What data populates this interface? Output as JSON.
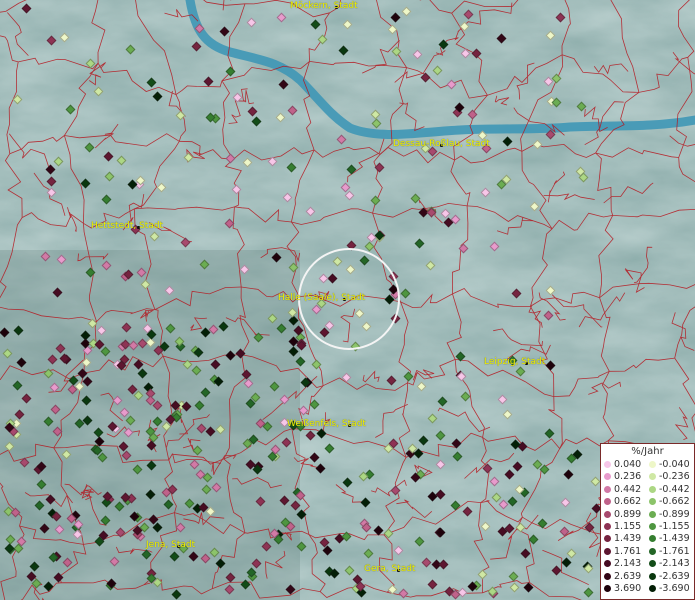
{
  "map": {
    "cities": [
      {
        "name": "Möckern, Stadt"
      },
      {
        "name": "Dessau-Roßlau, Stadt"
      },
      {
        "name": "Hettstedt, Stadt"
      },
      {
        "name": "Halle (Saale), Stadt"
      },
      {
        "name": "Leipzig, Stadt"
      },
      {
        "name": "Weißenfels, Stadt"
      },
      {
        "name": "Jena, Stadt"
      },
      {
        "name": "Gera, Stadt"
      }
    ]
  },
  "legend": {
    "title": "%/Jahr",
    "positive": [
      {
        "label": "0.040",
        "color": "#f7c6e8"
      },
      {
        "label": "0.236",
        "color": "#e89bcc"
      },
      {
        "label": "0.442",
        "color": "#d27aa6"
      },
      {
        "label": "0.662",
        "color": "#c0628a"
      },
      {
        "label": "0.899",
        "color": "#a84a6e"
      },
      {
        "label": "1.155",
        "color": "#8e3354"
      },
      {
        "label": "1.439",
        "color": "#762440"
      },
      {
        "label": "1.761",
        "color": "#5e1630"
      },
      {
        "label": "2.143",
        "color": "#470c22"
      },
      {
        "label": "2.639",
        "color": "#330616"
      },
      {
        "label": "3.690",
        "color": "#1e020b"
      }
    ],
    "negative": [
      {
        "label": "-0.040",
        "color": "#eef7c8"
      },
      {
        "label": "-0.236",
        "color": "#cfe8a4"
      },
      {
        "label": "-0.442",
        "color": "#acd784"
      },
      {
        "label": "-0.662",
        "color": "#8cc46a"
      },
      {
        "label": "-0.899",
        "color": "#6bad52"
      },
      {
        "label": "-1.155",
        "color": "#4e9640"
      },
      {
        "label": "-1.439",
        "color": "#357e30"
      },
      {
        "label": "-1.761",
        "color": "#236626"
      },
      {
        "label": "-2.143",
        "color": "#134d18"
      },
      {
        "label": "-2.639",
        "color": "#0a380f"
      },
      {
        "label": "-3.690",
        "color": "#031f06"
      }
    ]
  }
}
